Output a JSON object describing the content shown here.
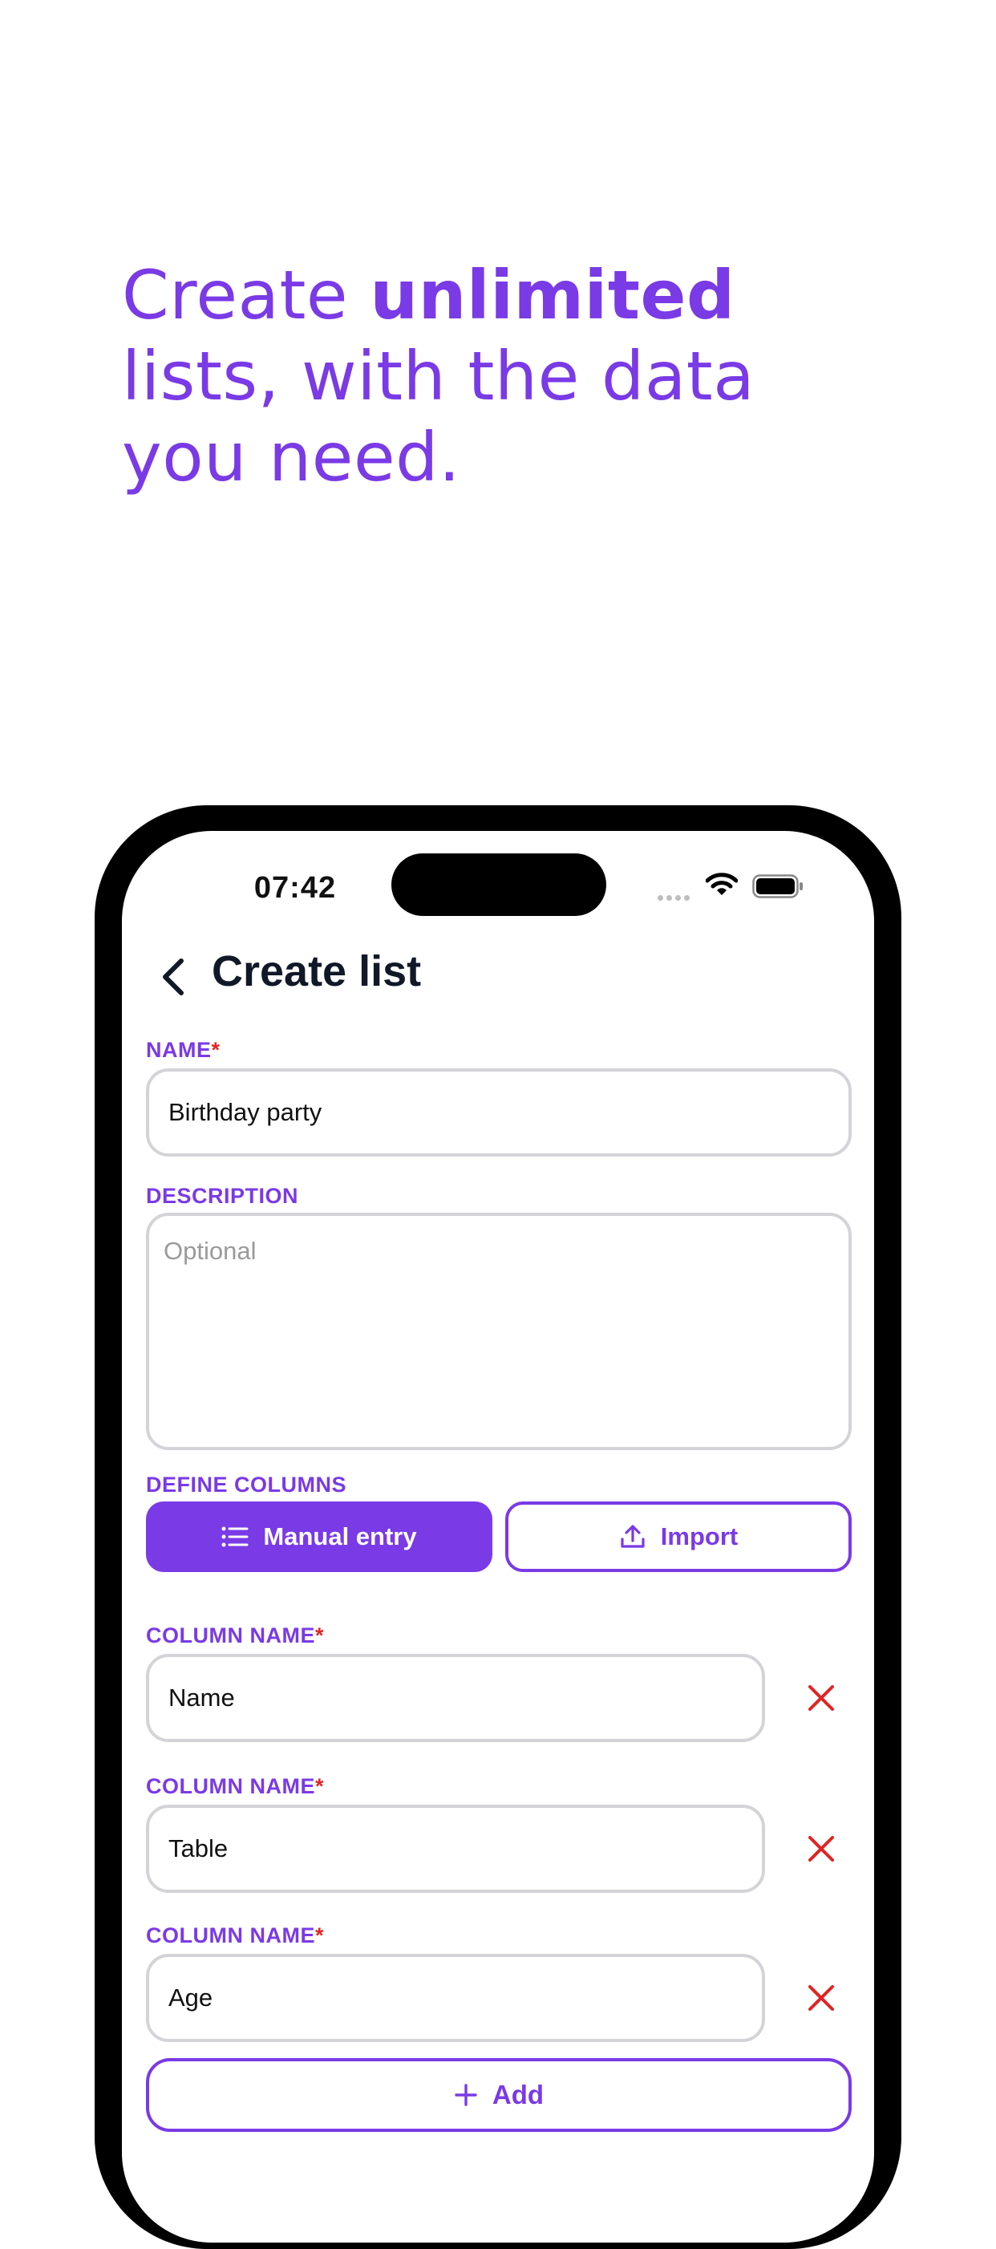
{
  "headline": {
    "part1": "Create ",
    "bold": "unlimited",
    "part2": " lists, with the data you need."
  },
  "status_bar": {
    "time": "07:42"
  },
  "nav": {
    "title": "Create list",
    "back_icon": "chevron-left-icon"
  },
  "form": {
    "name_label": "NAME",
    "required_mark": "*",
    "name_value": "Birthday party",
    "description_label": "DESCRIPTION",
    "description_placeholder": "Optional",
    "define_columns_label": "DEFINE COLUMNS",
    "segments": [
      {
        "label": "Manual entry",
        "icon": "list-icon",
        "active": true
      },
      {
        "label": "Import",
        "icon": "upload-icon",
        "active": false
      }
    ],
    "columns": [
      {
        "label": "COLUMN NAME",
        "value": "Name"
      },
      {
        "label": "COLUMN NAME",
        "value": "Table"
      },
      {
        "label": "COLUMN NAME",
        "value": "Age"
      }
    ],
    "add_label": "Add"
  },
  "colors": {
    "accent": "#7a3ae6",
    "danger": "#e02424",
    "border": "#d4d4d8"
  }
}
